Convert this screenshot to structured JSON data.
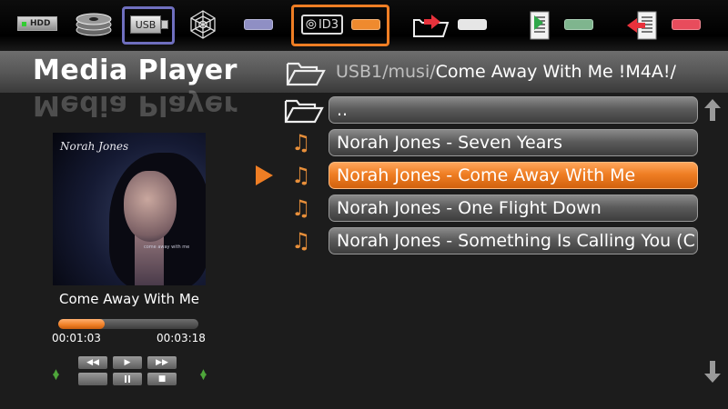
{
  "toolbar": {
    "hdd_label": "HDD",
    "usb_label": "USB",
    "id3_label": "ID3",
    "icons": [
      "hdd-icon",
      "disc-stack-icon",
      "usb-icon",
      "network-icon",
      "id3-icon",
      "move-folder-icon",
      "copy-file-icon",
      "delete-file-icon"
    ],
    "pill_colors": [
      "#8f8fc4",
      "#ef8a2e",
      "#e6e6e6",
      "#7fb58e",
      "#e84c5c"
    ],
    "highlight_colors": {
      "usb": "#6f6fbf",
      "id3": "#ef7e24"
    }
  },
  "header": {
    "title": "Media Player",
    "path_dim": "USB1/musi/",
    "path_current": "Come Away With Me !M4A!/"
  },
  "album": {
    "cover_artist": "Norah Jones",
    "cover_album": "come away with me",
    "song_title": "Come Away With Me",
    "elapsed": "00:01:03",
    "total": "00:03:18",
    "progress": 0.33
  },
  "controls": {
    "rewind": "◀◀",
    "play": "▶",
    "fast_forward": "▶▶",
    "stop": "■"
  },
  "files": {
    "parent": "..",
    "items": [
      {
        "label": "Norah Jones - Seven Years",
        "selected": false
      },
      {
        "label": "Norah Jones - Come Away With Me",
        "selected": true
      },
      {
        "label": "Norah Jones - One Flight Down",
        "selected": false
      },
      {
        "label": "Norah Jones - Something Is Calling You (C",
        "selected": false
      }
    ]
  },
  "colors": {
    "accent": "#ef7e24",
    "band": "#5a5a5a",
    "background": "#1c1c1c"
  }
}
